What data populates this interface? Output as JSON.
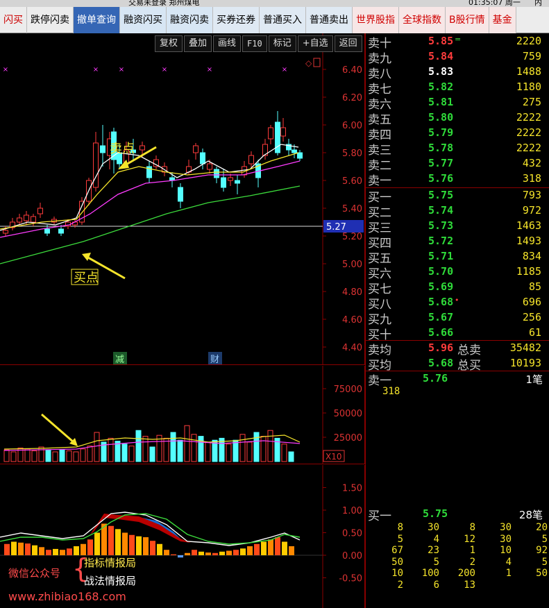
{
  "topbar": {
    "left_text": "交易未登录  郑州煤电",
    "time": "01:35:07 周一",
    "right": "内"
  },
  "toolbar": {
    "buttons": [
      {
        "label": "闪买",
        "style": "c0"
      },
      {
        "label": "跌停闪卖",
        "style": "c1"
      },
      {
        "label": "撤单查询",
        "style": "c2"
      },
      {
        "label": "融资闪买",
        "style": "c3"
      },
      {
        "label": "融资闪卖",
        "style": "c3"
      },
      {
        "label": "买券还券",
        "style": "c4"
      },
      {
        "label": "普通买入",
        "style": "c4"
      },
      {
        "label": "普通卖出",
        "style": "c4"
      },
      {
        "label": "世界股指",
        "style": "c5"
      },
      {
        "label": "全球指数",
        "style": "c5"
      },
      {
        "label": "B股行情",
        "style": "c5"
      },
      {
        "label": "基金",
        "style": "c5"
      }
    ]
  },
  "chart_toolbar": [
    "复权",
    "叠加",
    "画线",
    "F10",
    "标记",
    "+自选",
    "返回"
  ],
  "price_chart": {
    "y_ticks": [
      "6.40",
      "6.20",
      "6.00",
      "5.80",
      "5.60",
      "5.40",
      "5.20",
      "5.00",
      "4.80",
      "4.60",
      "4.40"
    ],
    "current_price": "5.27",
    "sell_label": "卖点",
    "buy_label": "买点",
    "mark_jian": "减",
    "mark_cai": "财"
  },
  "volume_chart": {
    "y_ticks": [
      "75000",
      "50000",
      "25000"
    ],
    "unit": "X10"
  },
  "macd_chart": {
    "y_ticks": [
      "1.50",
      "1.00",
      "0.50",
      "0.00",
      "-0.50"
    ]
  },
  "order_book": {
    "asks": [
      {
        "label": "卖十",
        "price": "5.85",
        "vol": "2220",
        "color": "up",
        "flag": "="
      },
      {
        "label": "卖九",
        "price": "5.84",
        "vol": "759",
        "color": "up"
      },
      {
        "label": "卖八",
        "price": "5.83",
        "vol": "1488",
        "color": "wh"
      },
      {
        "label": "卖七",
        "price": "5.82",
        "vol": "1180",
        "color": "dn"
      },
      {
        "label": "卖六",
        "price": "5.81",
        "vol": "275",
        "color": "dn"
      },
      {
        "label": "卖五",
        "price": "5.80",
        "vol": "2222",
        "color": "dn"
      },
      {
        "label": "卖四",
        "price": "5.79",
        "vol": "2222",
        "color": "dn"
      },
      {
        "label": "卖三",
        "price": "5.78",
        "vol": "2222",
        "color": "dn"
      },
      {
        "label": "卖二",
        "price": "5.77",
        "vol": "432",
        "color": "dn"
      },
      {
        "label": "卖一",
        "price": "5.76",
        "vol": "318",
        "color": "dn"
      }
    ],
    "bids": [
      {
        "label": "买一",
        "price": "5.75",
        "vol": "793",
        "color": "dn"
      },
      {
        "label": "买二",
        "price": "5.74",
        "vol": "972",
        "color": "dn"
      },
      {
        "label": "买三",
        "price": "5.73",
        "vol": "1463",
        "color": "dn"
      },
      {
        "label": "买四",
        "price": "5.72",
        "vol": "1493",
        "color": "dn"
      },
      {
        "label": "买五",
        "price": "5.71",
        "vol": "834",
        "color": "dn"
      },
      {
        "label": "买六",
        "price": "5.70",
        "vol": "1185",
        "color": "dn"
      },
      {
        "label": "买七",
        "price": "5.69",
        "vol": "85",
        "color": "dn"
      },
      {
        "label": "买八",
        "price": "5.68",
        "vol": "696",
        "color": "dn",
        "flag": "•"
      },
      {
        "label": "买九",
        "price": "5.67",
        "vol": "256",
        "color": "dn"
      },
      {
        "label": "买十",
        "price": "5.66",
        "vol": "61",
        "color": "dn"
      }
    ],
    "avg_sell_label": "卖均",
    "avg_sell_price": "5.96",
    "total_sell_label": "总卖",
    "total_sell": "35482",
    "avg_buy_label": "买均",
    "avg_buy_price": "5.68",
    "total_buy_label": "总买",
    "total_buy": "10193"
  },
  "queue1": {
    "label": "卖一",
    "price": "5.76",
    "count": "1笔",
    "items": [
      "318"
    ]
  },
  "queue2": {
    "label": "买一",
    "price": "5.75",
    "count": "28笔",
    "rows": [
      [
        "8",
        "30",
        "8",
        "30",
        "20"
      ],
      [
        "5",
        "4",
        "12",
        "30",
        "5"
      ],
      [
        "67",
        "23",
        "1",
        "10",
        "92"
      ],
      [
        "50",
        "5",
        "2",
        "4",
        "5"
      ],
      [
        "10",
        "100",
        "200",
        "1",
        "50"
      ],
      [
        "2",
        "6",
        "13",
        "",
        ""
      ]
    ]
  },
  "watermark": {
    "wx": "微信公众号",
    "line1": "指标情报局",
    "line2": "战法情报局",
    "url": "www.zhibiao168.com"
  },
  "colors": {
    "up": "#ff3c3c",
    "down": "#2fdb3a",
    "border": "#8b0000"
  }
}
